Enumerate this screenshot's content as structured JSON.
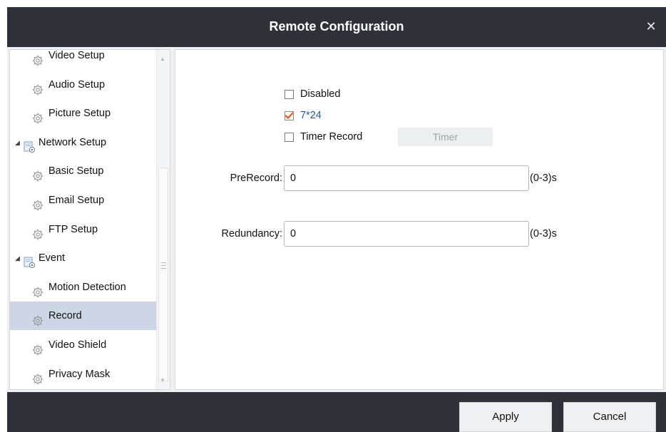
{
  "window": {
    "title": "Remote Configuration",
    "close_glyph": "✕"
  },
  "tree": {
    "items": [
      {
        "label": "Video Setup",
        "type": "child",
        "icon": "gear-icon"
      },
      {
        "label": "Audio Setup",
        "type": "child",
        "icon": "gear-icon"
      },
      {
        "label": "Picture Setup",
        "type": "child",
        "icon": "gear-icon"
      },
      {
        "label": "Network Setup",
        "type": "group",
        "icon": "folder-settings-icon",
        "expanded": true
      },
      {
        "label": "Basic Setup",
        "type": "child",
        "icon": "gear-icon"
      },
      {
        "label": "Email Setup",
        "type": "child",
        "icon": "gear-icon"
      },
      {
        "label": "FTP Setup",
        "type": "child",
        "icon": "gear-icon"
      },
      {
        "label": "Event",
        "type": "group",
        "icon": "folder-settings-icon",
        "expanded": true
      },
      {
        "label": "Motion Detection",
        "type": "child",
        "icon": "gear-icon"
      },
      {
        "label": "Record",
        "type": "child",
        "icon": "gear-icon",
        "selected": true
      },
      {
        "label": "Video Shield",
        "type": "child",
        "icon": "gear-icon"
      },
      {
        "label": "Privacy Mask",
        "type": "child",
        "icon": "gear-icon"
      }
    ]
  },
  "record": {
    "options": [
      {
        "label": "Disabled",
        "checked": false
      },
      {
        "label": "7*24",
        "checked": true
      },
      {
        "label": "Timer Record",
        "checked": false
      }
    ],
    "timer_button": "Timer",
    "prerecord": {
      "label": "PreRecord:",
      "value": "0",
      "unit": "(0-3)s"
    },
    "redundancy": {
      "label": "Redundancy:",
      "value": "0",
      "unit": "(0-3)s"
    }
  },
  "footer": {
    "apply_label": "Apply",
    "cancel_label": "Cancel"
  },
  "colors": {
    "titlebar": "#2e3238",
    "selected_row": "#cdd6e4",
    "check_mark": "#e8642a",
    "active_option_text": "#2a5a8f"
  }
}
